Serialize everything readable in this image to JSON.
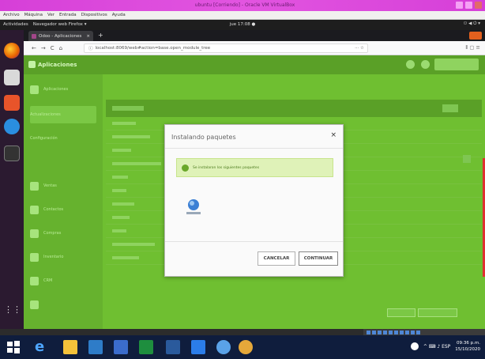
{
  "host": {
    "window_title": "ubuntu [Corriendo] - Oracle VM VirtualBox",
    "menu": [
      "Archivo",
      "Máquina",
      "Ver",
      "Entrada",
      "Dispositivos",
      "Ayuda"
    ]
  },
  "ubuntu": {
    "activities": "Actividades",
    "app_menu": "Navegador web Firefox ▾",
    "clock": "jue 17:08 ●",
    "status_icons": "⚇ ◀ ⏻ ▾"
  },
  "firefox": {
    "tab_title": "Odoo - Aplicaciones",
    "tab_close": "×",
    "new_tab": "+",
    "url": "localhost:8069/web#action=base.open_module_tree",
    "nav_back": "←",
    "nav_forward": "→",
    "nav_reload": "C",
    "nav_home": "⌂",
    "page_actions": "··· ☆",
    "toolbar_icons": "⫴ ▢ ≡"
  },
  "app": {
    "name": "Aplicaciones",
    "sidebar": [
      "Aplicaciones",
      "Actualizaciones",
      "Configuración",
      "Ventas",
      "Contactos",
      "Compras",
      "Inventario",
      "CRM"
    ]
  },
  "modal": {
    "title": "Instalando paquetes",
    "close": "×",
    "notice": "Se instalaron los siguientes paquetes",
    "cancel_label": "CANCELAR",
    "continue_label": "CONTINUAR"
  },
  "windows": {
    "clock_time": "09:36 p.m.",
    "clock_date": "15/10/2020",
    "tray": "^ ⌨ ♪ ESP"
  },
  "colors": {
    "page_green": "#6fbf31",
    "header_green": "#5aa027",
    "modal_bg": "#fafafa",
    "taskbar": "#0f1d3d",
    "host_title": "#e255e0"
  }
}
